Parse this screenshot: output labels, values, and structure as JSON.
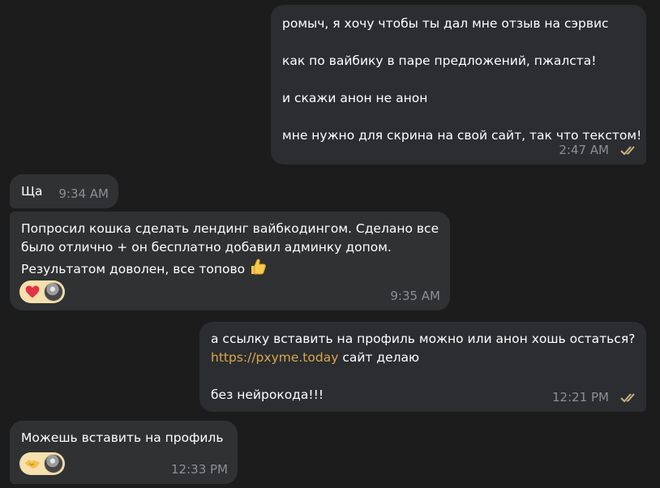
{
  "messages": [
    {
      "lines": [
        "ромыч, я хочу чтобы ты дал мне отзыв на сэрвис",
        "",
        "как по вайбику в паре предложений, пжалста!",
        "",
        "и скажи анон не анон",
        "",
        "мне нужно для скрина на свой сайт, так что текстом!"
      ],
      "time": "2:47 AM"
    },
    {
      "text": "Ща",
      "time": "9:34 AM"
    },
    {
      "lines": [
        "Попросил кошка сделать лендинг вайбкодингом. Сделано все",
        "было отлично + он бесплатно добавил админку допом.",
        "Результатом доволен, все топово"
      ],
      "reaction_emoji": "heart-icon",
      "time": "9:35 AM"
    },
    {
      "line1": "а ссылку вставить на профиль можно или анон хошь остаться?",
      "link": "https://pxyme.today",
      "line2_rest": " сайт делаю",
      "line3": "без нейрокода!!!",
      "time": "12:21 PM"
    },
    {
      "text": "Можешь вставить на профиль",
      "reaction_emoji": "handshake-icon",
      "time": "12:33 PM"
    }
  ],
  "colors": {
    "background": "#1c1c1d",
    "bubble": "#2f3133",
    "meta": "#8c8f92",
    "link": "#d9a84b",
    "reaction": "#f6e0ad",
    "ticks": "#c9b27d"
  }
}
